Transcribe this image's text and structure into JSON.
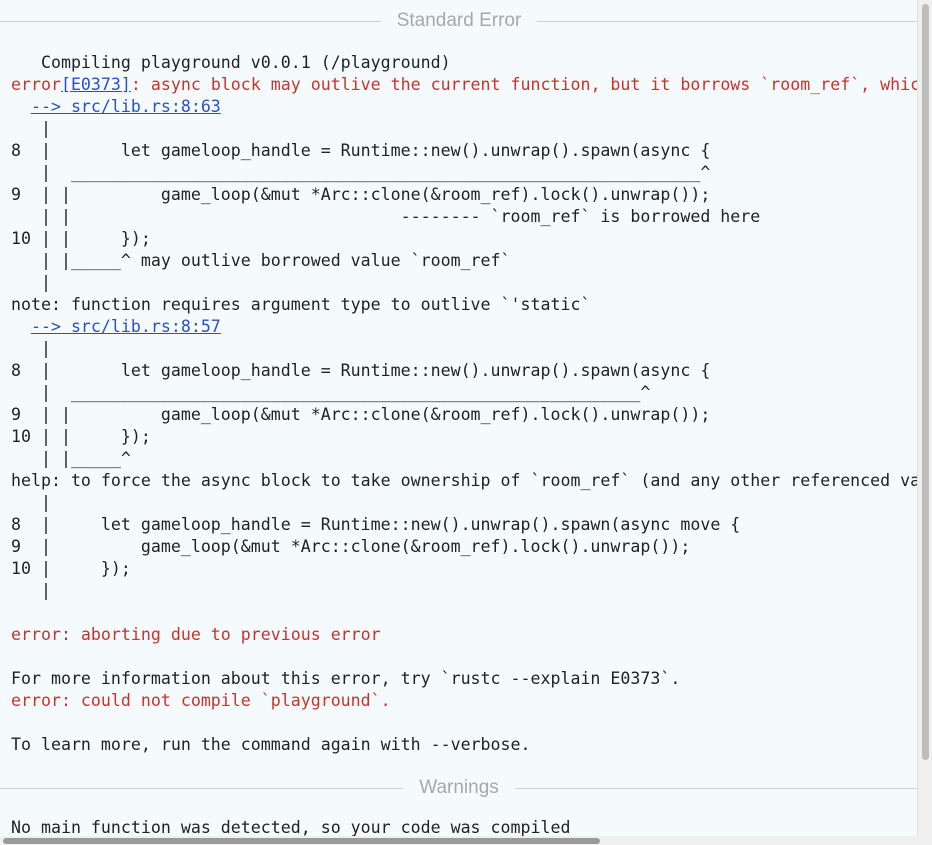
{
  "stderr_header": "Standard Error",
  "warnings_header": "Warnings",
  "lines": [
    {
      "parts": [
        {
          "t": "   Compiling playground v0.0.1 (/playground)"
        }
      ]
    },
    {
      "parts": [
        {
          "t": "error",
          "c": "err"
        },
        {
          "t": "[E0373]",
          "c": "link"
        },
        {
          "t": ": async block may outlive the current function, but it borrows `room_ref`, which is owned by the current function",
          "c": "err"
        }
      ]
    },
    {
      "parts": [
        {
          "t": "  "
        },
        {
          "t": "--> src/lib.rs:8:63",
          "c": "link"
        }
      ]
    },
    {
      "parts": [
        {
          "t": "   |"
        }
      ]
    },
    {
      "parts": [
        {
          "t": "8  |       let gameloop_handle = Runtime::new().unwrap().spawn(async {"
        }
      ]
    },
    {
      "parts": [
        {
          "t": "   |  _______________________________________________________________^"
        }
      ]
    },
    {
      "parts": [
        {
          "t": "9  | |         game_loop(&mut *Arc::clone(&room_ref).lock().unwrap());"
        }
      ]
    },
    {
      "parts": [
        {
          "t": "   | |                                 -------- `room_ref` is borrowed here"
        }
      ]
    },
    {
      "parts": [
        {
          "t": "10 | |     });"
        }
      ]
    },
    {
      "parts": [
        {
          "t": "   | |_____^ may outlive borrowed value `room_ref`"
        }
      ]
    },
    {
      "parts": [
        {
          "t": "   |"
        }
      ]
    },
    {
      "parts": [
        {
          "t": "note: function requires argument type to outlive `'static`"
        }
      ]
    },
    {
      "parts": [
        {
          "t": "  "
        },
        {
          "t": "--> src/lib.rs:8:57",
          "c": "link"
        }
      ]
    },
    {
      "parts": [
        {
          "t": "   |"
        }
      ]
    },
    {
      "parts": [
        {
          "t": "8  |       let gameloop_handle = Runtime::new().unwrap().spawn(async {"
        }
      ]
    },
    {
      "parts": [
        {
          "t": "   |  _________________________________________________________^"
        }
      ]
    },
    {
      "parts": [
        {
          "t": "9  | |         game_loop(&mut *Arc::clone(&room_ref).lock().unwrap());"
        }
      ]
    },
    {
      "parts": [
        {
          "t": "10 | |     });"
        }
      ]
    },
    {
      "parts": [
        {
          "t": "   | |_____^"
        }
      ]
    },
    {
      "parts": [
        {
          "t": "help: to force the async block to take ownership of `room_ref` (and any other referenced variables), use the `move` keyword"
        }
      ]
    },
    {
      "parts": [
        {
          "t": "   |"
        }
      ]
    },
    {
      "parts": [
        {
          "t": "8  |     let gameloop_handle = Runtime::new().unwrap().spawn(async move {"
        }
      ]
    },
    {
      "parts": [
        {
          "t": "9  |         game_loop(&mut *Arc::clone(&room_ref).lock().unwrap());"
        }
      ]
    },
    {
      "parts": [
        {
          "t": "10 |     });"
        }
      ]
    },
    {
      "parts": [
        {
          "t": "   |"
        }
      ]
    },
    {
      "parts": [
        {
          "t": ""
        }
      ]
    },
    {
      "parts": [
        {
          "t": "error: aborting due to previous error",
          "c": "err"
        }
      ]
    },
    {
      "parts": [
        {
          "t": ""
        }
      ]
    },
    {
      "parts": [
        {
          "t": "For more information about this error, try `rustc --explain E0373`."
        }
      ]
    },
    {
      "parts": [
        {
          "t": "error: could not compile `playground`.",
          "c": "err"
        }
      ]
    },
    {
      "parts": [
        {
          "t": ""
        }
      ]
    },
    {
      "parts": [
        {
          "t": "To learn more, run the command again with --verbose."
        }
      ]
    }
  ],
  "warnings_text": "No main function was detected, so your code was compiled",
  "colors": {
    "error": "#c8322d",
    "link": "#2b4fc7",
    "text": "#222222",
    "background": "#f5fbfd",
    "header": "#a8a8a8"
  }
}
